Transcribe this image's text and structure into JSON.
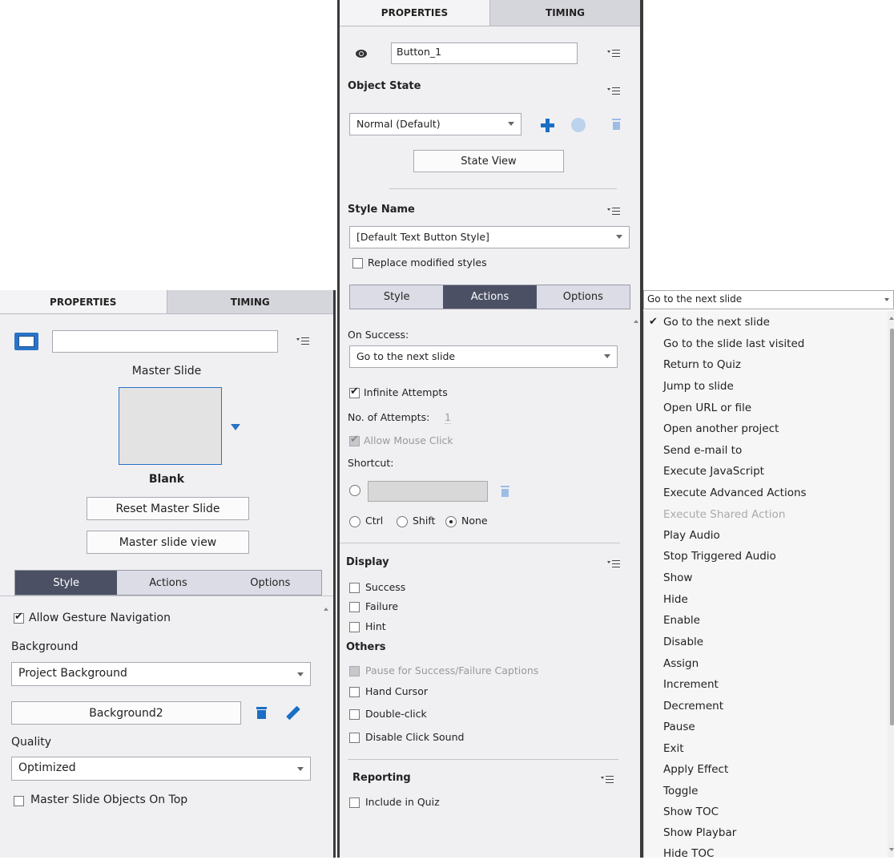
{
  "left_panel": {
    "tabs": [
      "PROPERTIES",
      "TIMING"
    ],
    "name_value": "",
    "master_slide_label": "Master Slide",
    "thumbnail_label": "Blank",
    "reset_master_button": "Reset Master Slide",
    "master_view_button": "Master slide view",
    "segments": [
      "Style",
      "Actions",
      "Options"
    ],
    "selected_segment": "Style",
    "allow_gesture": "Allow Gesture Navigation",
    "background_label": "Background",
    "background_select": "Project Background",
    "background_image_button": "Background2",
    "quality_label": "Quality",
    "quality_select": "Optimized",
    "master_objects_on_top": "Master Slide Objects On Top"
  },
  "middle_panel": {
    "tabs": [
      "PROPERTIES",
      "TIMING"
    ],
    "name_value": "Button_1",
    "object_state_label": "Object State",
    "state_select": "Normal (Default)",
    "state_view_button": "State View",
    "style_name_label": "Style Name",
    "style_select": "[Default Text Button Style]",
    "replace_styles": "Replace modified styles",
    "segments": [
      "Style",
      "Actions",
      "Options"
    ],
    "selected_segment": "Actions",
    "on_success_label": "On Success:",
    "on_success_select": "Go to the next slide",
    "infinite_attempts": "Infinite Attempts",
    "attempts_label": "No. of Attempts:",
    "attempts_value": "1",
    "allow_mouse_click": "Allow Mouse Click",
    "shortcut_label": "Shortcut:",
    "ctrl": "Ctrl",
    "shift": "Shift",
    "none": "None",
    "display_label": "Display",
    "success": "Success",
    "failure": "Failure",
    "hint": "Hint",
    "others_label": "Others",
    "pause_captions": "Pause for Success/Failure Captions",
    "hand_cursor": "Hand Cursor",
    "double_click": "Double-click",
    "disable_click_sound": "Disable Click Sound",
    "reporting_label": "Reporting",
    "include_in_quiz": "Include in Quiz"
  },
  "right_dropdown": {
    "selected": "Go to the next slide",
    "items": [
      "Go to the next slide",
      "Go to the slide last visited",
      "Return to Quiz",
      "Jump to slide",
      "Open URL or file",
      "Open another project",
      "Send e-mail to",
      "Execute JavaScript",
      "Execute Advanced Actions",
      "Execute Shared Action",
      "Play Audio",
      "Stop Triggered Audio",
      "Show",
      "Hide",
      "Enable",
      "Disable",
      "Assign",
      "Increment",
      "Decrement",
      "Pause",
      "Exit",
      "Apply Effect",
      "Toggle",
      "Show TOC",
      "Show Playbar",
      "Hide TOC"
    ],
    "disabled_items": [
      "Execute Shared Action"
    ]
  },
  "colors": {
    "accent_blue": "#1a6fc4",
    "segment_selected": "#4b5064",
    "panel_bg": "#f0f0f3"
  }
}
